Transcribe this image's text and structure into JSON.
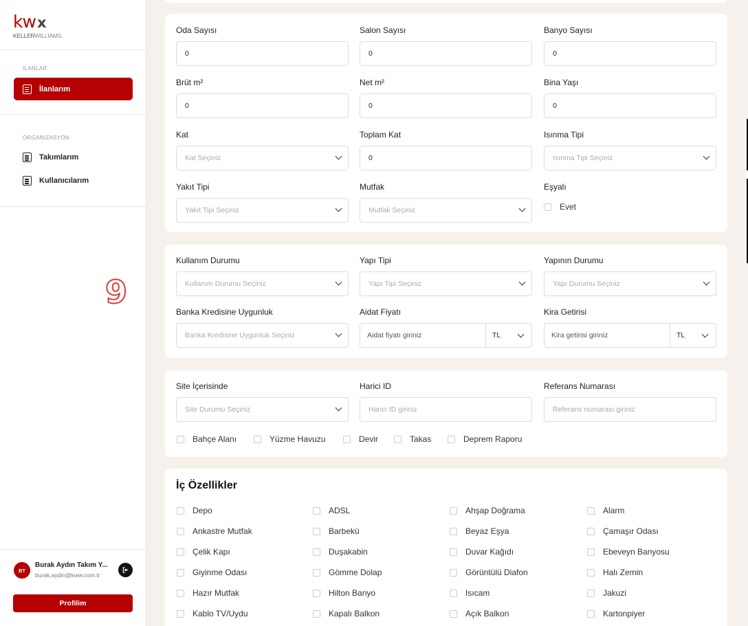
{
  "brand": {
    "kw": "kw",
    "x": "x",
    "sub_a": "KELLER",
    "sub_b": "WILLIAMS."
  },
  "sidebar": {
    "section1": "İLANLAR",
    "active_item": "İlanlarım",
    "section2": "ORGANIZASYON",
    "items": [
      "Takımlarım",
      "Kullanıcılarım"
    ],
    "badge_number": "9"
  },
  "user": {
    "initials": "BT",
    "name": "Burak Aydın Takım Y...",
    "email": "burak.aydin@kww.com.tr",
    "profile_button": "Profilim"
  },
  "card1": {
    "oda": {
      "label": "Oda Sayısı",
      "value": "0"
    },
    "salon": {
      "label": "Salon Sayısı",
      "value": "0"
    },
    "banyo": {
      "label": "Banyo Sayısı",
      "value": "0"
    },
    "brut": {
      "label": "Brüt m²",
      "value": "0"
    },
    "net": {
      "label": "Net m²",
      "value": "0"
    },
    "bina_yasi": {
      "label": "Bina Yaşı",
      "value": "0"
    },
    "kat": {
      "label": "Kat",
      "placeholder": "Kat Seçiniz"
    },
    "toplam_kat": {
      "label": "Toplam Kat",
      "value": "0"
    },
    "isinma": {
      "label": "Isınma Tipi",
      "placeholder": "Isınma Tipi Seçiniz"
    },
    "yakit": {
      "label": "Yakıt Tipi",
      "placeholder": "Yakıt Tipi Seçiniz"
    },
    "mutfak": {
      "label": "Mutfak",
      "placeholder": "Mutfak Seçiniz"
    },
    "esyali": {
      "label": "Eşyalı",
      "option": "Evet"
    }
  },
  "card2": {
    "kullanim": {
      "label": "Kullanım Durumu",
      "placeholder": "Kullanım Durumu Seçiniz"
    },
    "yapi_tipi": {
      "label": "Yapı Tipi",
      "placeholder": "Yapı Tipi Seçiniz"
    },
    "yapi_durumu": {
      "label": "Yapının Durumu",
      "placeholder": "Yapı Durumu Seçiniz"
    },
    "kredi": {
      "label": "Banka Kredisine Uygunluk",
      "placeholder": "Banka Kredisine Uygunluk Seçiniz"
    },
    "aidat": {
      "label": "Aidat Fiyatı",
      "placeholder": "Aidat fiyatı giriniz",
      "currency": "TL"
    },
    "kira": {
      "label": "Kira Getirisi",
      "placeholder": "Kira getirisi giriniz",
      "currency": "TL"
    }
  },
  "card3": {
    "site": {
      "label": "Site İçerisinde",
      "placeholder": "Site Durumu Seçiniz"
    },
    "harici": {
      "label": "Harici ID",
      "placeholder": "Harici ID giriniz"
    },
    "referans": {
      "label": "Referans Numarası",
      "placeholder": "Referans numarası giriniz"
    },
    "checks": [
      "Bahçe Alanı",
      "Yüzme Havuzu",
      "Devir",
      "Takas",
      "Deprem Raporu"
    ]
  },
  "card4": {
    "title": "İç Özellikler",
    "features": [
      "Depo",
      "ADSL",
      "Ahşap Doğrama",
      "Alarm",
      "Ankastre Mutfak",
      "Barbekü",
      "Beyaz Eşya",
      "Çamaşır Odası",
      "Çelik Kapı",
      "Duşakabin",
      "Duvar Kağıdı",
      "Ebeveyn Banyosu",
      "Giyinme Odası",
      "Gömme Dolap",
      "Görüntülü Diafon",
      "Halı Zemin",
      "Hazır Mutfak",
      "Hilton Banyo",
      "Isıcam",
      "Jakuzi",
      "Kablo TV/Uydu",
      "Kapalı Balkon",
      "Açık Balkon",
      "Kartonpiyer"
    ]
  }
}
